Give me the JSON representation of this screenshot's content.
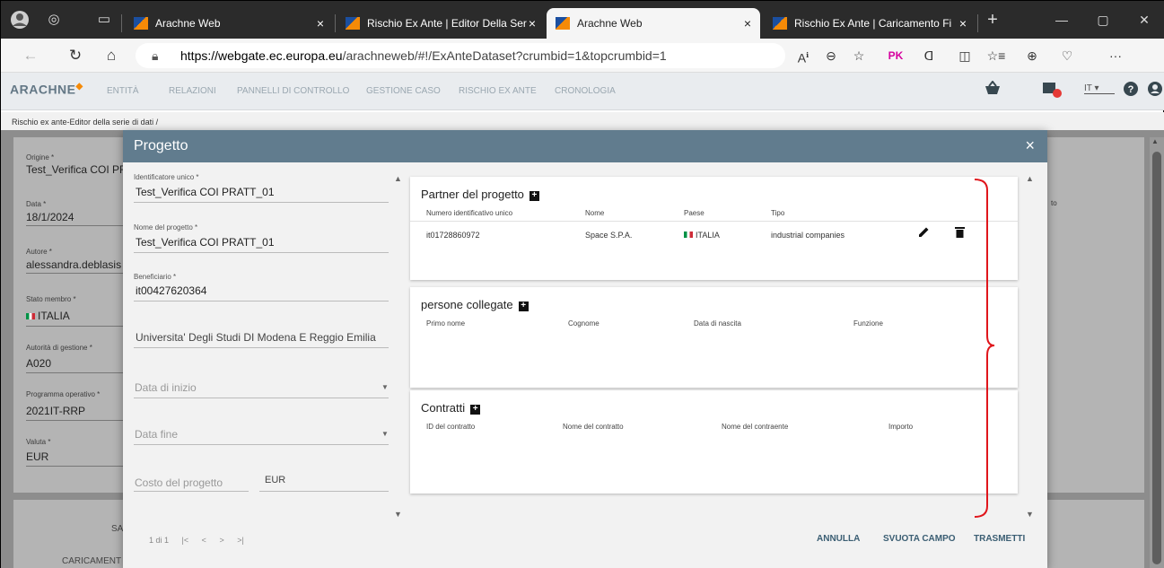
{
  "browser": {
    "tabs": [
      {
        "title": "Arachne Web",
        "active": false
      },
      {
        "title": "Rischio Ex Ante | Editor Della Ser",
        "active": false
      },
      {
        "title": "Arachne Web",
        "active": true
      },
      {
        "title": "Rischio Ex Ante | Caricamento Fi",
        "active": false
      }
    ],
    "new_tab": "+",
    "close": "×",
    "url_host": "https://webgate.ec.europa.eu",
    "url_path": "/arachneweb/#!/ExAnteDataset?crumbid=1&topcrumbid=1",
    "profile_badge": "PK",
    "more": "···"
  },
  "app": {
    "brand": "ARACHNE",
    "menu": [
      "ENTITÀ",
      "RELAZIONI",
      "PANNELLI DI CONTROLLO",
      "GESTIONE CASO",
      "RISCHIO EX ANTE",
      "CRONOLOGIA"
    ],
    "language": "IT",
    "breadcrumb": "Rischio ex ante-Editor della serie di dati  /"
  },
  "background_form": {
    "fields": [
      {
        "label": "Origine *",
        "value": "Test_Verifica COI PRATT"
      },
      {
        "label": "Data *",
        "value": "18/1/2024"
      },
      {
        "label": "Autore *",
        "value": "alessandra.deblasis"
      },
      {
        "label": "Stato membro *",
        "value": "ITALIA"
      },
      {
        "label": "Autorità di gestione *",
        "value": "A020"
      },
      {
        "label": "Programma operativo *",
        "value": "2021IT-RRP"
      },
      {
        "label": "Valuta *",
        "value": "EUR"
      }
    ],
    "side_text": "to",
    "button_1": "SA",
    "button_2": "CARICAMENT"
  },
  "modal": {
    "title": "Progetto",
    "close": "×",
    "left": {
      "fields": [
        {
          "label": "Identificatore unico *",
          "value": "Test_Verifica COI PRATT_01"
        },
        {
          "label": "Nome del progetto *",
          "value": "Test_Verifica COI PRATT_01"
        },
        {
          "label": "Beneficiario *",
          "value": "it00427620364"
        }
      ],
      "beneficiary_name": "Universita' Degli Studi DI Modena E Reggio Emilia",
      "start_date_placeholder": "Data di inizio",
      "end_date_placeholder": "Data fine",
      "cost_placeholder": "Costo del progetto",
      "currency": "EUR"
    },
    "partners": {
      "title": "Partner del progetto",
      "columns": [
        "Numero identificativo unico",
        "Nome",
        "Paese",
        "Tipo"
      ],
      "rows": [
        {
          "id": "it01728860972",
          "name": "Space S.P.A.",
          "country": "ITALIA",
          "type": "industrial companies"
        }
      ]
    },
    "persons": {
      "title": "persone collegate",
      "columns": [
        "Primo nome",
        "Cognome",
        "Data di nascita",
        "Funzione"
      ]
    },
    "contracts": {
      "title": "Contratti",
      "columns": [
        "ID del contratto",
        "Nome del contratto",
        "Nome del contraente",
        "Importo"
      ]
    },
    "pager": {
      "page": "1 di 1"
    },
    "buttons": {
      "cancel": "ANNULLA",
      "clear": "SVUOTA CAMPO",
      "submit": "TRASMETTI"
    }
  },
  "colors": {
    "modal_header": "#617c8e",
    "annotation": "#e0151b",
    "brand_accent": "#f58a07"
  }
}
